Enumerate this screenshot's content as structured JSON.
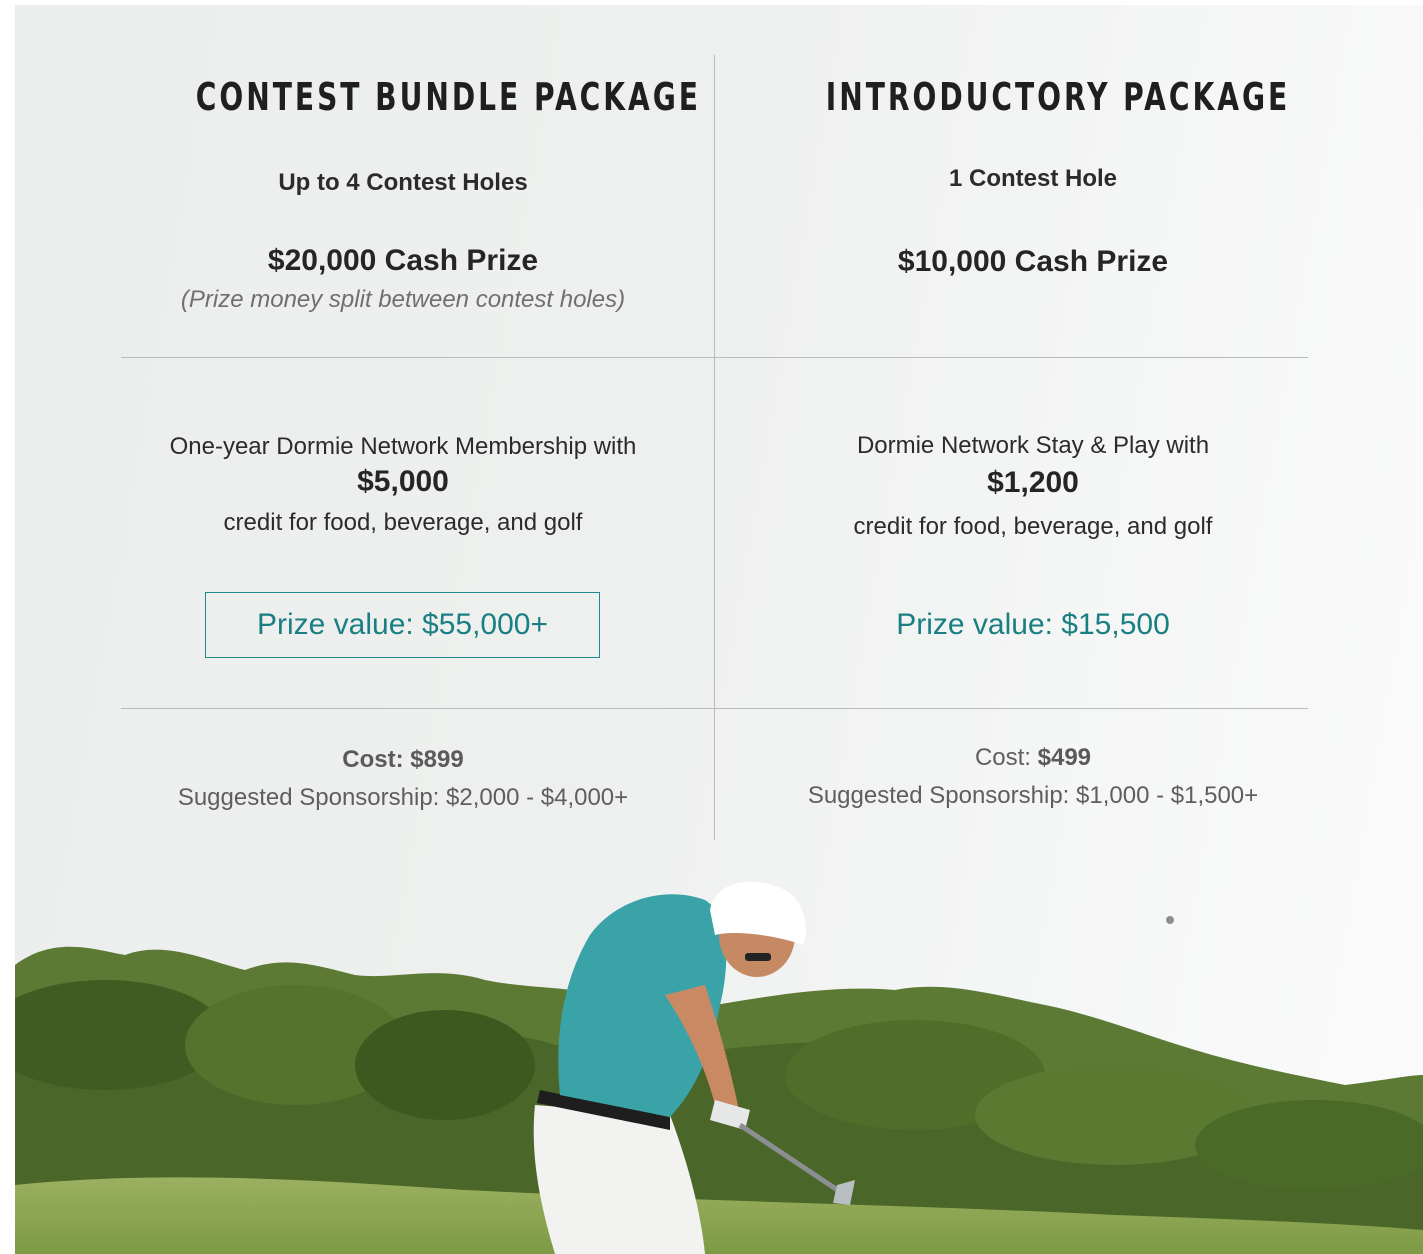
{
  "packages": {
    "left": {
      "title": "CONTEST BUNDLE PACKAGE",
      "holes": "Up to 4 Contest Holes",
      "cash_prize": "$20,000 Cash Prize",
      "split_note": "(Prize money split between contest holes)",
      "membership_line": "One-year Dormie Network Membership with",
      "credit_amount": "$5,000",
      "credit_line": "credit for food, beverage, and golf",
      "prize_value": "Prize value: $55,000+",
      "cost_label": "Cost: $899",
      "sponsorship": "Suggested Sponsorship: $2,000 - $4,000+"
    },
    "right": {
      "title": "INTRODUCTORY PACKAGE",
      "holes": "1 Contest Hole",
      "cash_prize": "$10,000 Cash Prize",
      "membership_line": "Dormie Network Stay & Play with",
      "credit_amount": "$1,200",
      "credit_line": "credit for food, beverage, and golf",
      "prize_value": "Prize value: $15,500",
      "cost_prefix": "Cost: ",
      "cost_value": "$499",
      "sponsorship": "Suggested Sponsorship: $1,000 - $1,500+"
    }
  },
  "colors": {
    "accent_teal": "#1a7f82",
    "divider": "#b9bcbb",
    "panel_bg": "#eef0ef"
  },
  "image": {
    "subject": "golfer-swing-photo"
  }
}
